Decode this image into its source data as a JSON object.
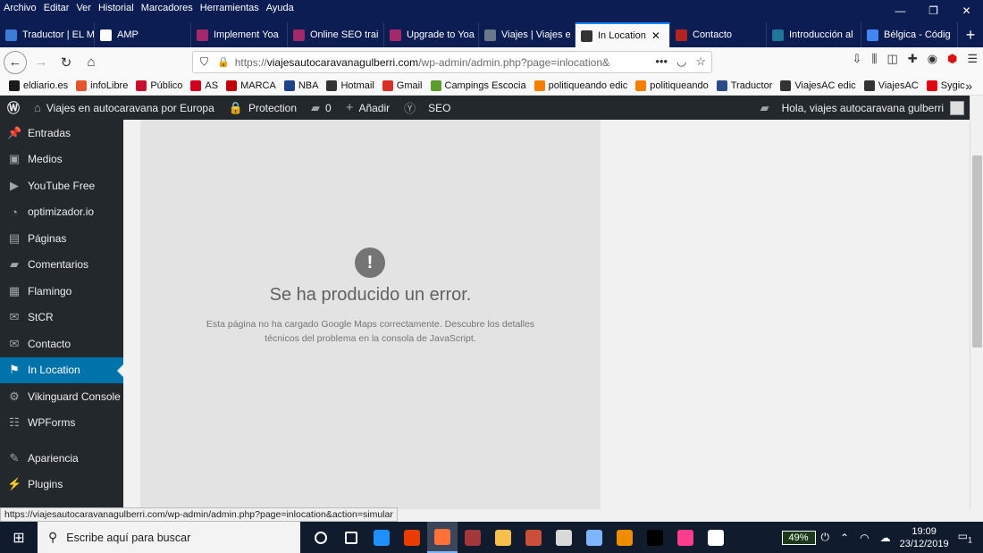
{
  "menubar": [
    "Archivo",
    "Editar",
    "Ver",
    "Historial",
    "Marcadores",
    "Herramientas",
    "Ayuda"
  ],
  "window_controls": [
    "—",
    "❐",
    "✕"
  ],
  "tabs": [
    {
      "label": "Traductor | EL M",
      "color": "#3c7bd6"
    },
    {
      "label": "AMP",
      "color": "#ffffff"
    },
    {
      "label": "Implement Yoa",
      "color": "#a4286a"
    },
    {
      "label": "Online SEO trai",
      "color": "#a4286a"
    },
    {
      "label": "Upgrade to Yoa",
      "color": "#a4286a"
    },
    {
      "label": "Viajes | Viajes e",
      "color": "#6b7a8a"
    },
    {
      "label": "In Location",
      "color": "#333333"
    },
    {
      "label": "Contacto",
      "color": "#b5241e"
    },
    {
      "label": "Introducción al",
      "color": "#21759b"
    },
    {
      "label": "Bélgica - Códig",
      "color": "#4285f4"
    }
  ],
  "url": {
    "prefix": "https://",
    "domain": "viajesautocaravanagulberri.com",
    "path": "/wp-admin/admin.php?page=inlocation&ac"
  },
  "bookmarks": [
    {
      "label": "eldiario.es",
      "color": "#1a1a1a"
    },
    {
      "label": "infoLibre",
      "color": "#e4572e"
    },
    {
      "label": "Público",
      "color": "#c8102e"
    },
    {
      "label": "AS",
      "color": "#d0021b"
    },
    {
      "label": "MARCA",
      "color": "#c20000"
    },
    {
      "label": "NBA",
      "color": "#1d428a"
    },
    {
      "label": "Hotmail",
      "color": "#333333"
    },
    {
      "label": "Gmail",
      "color": "#d93025"
    },
    {
      "label": "Campings Escocia",
      "color": "#5c9c2a"
    },
    {
      "label": "politiqueando edic",
      "color": "#f57d00"
    },
    {
      "label": "politiqueando",
      "color": "#f57d00"
    },
    {
      "label": "Traductor",
      "color": "#2b4c8c"
    },
    {
      "label": "ViajesAC edic",
      "color": "#333333"
    },
    {
      "label": "ViajesAC",
      "color": "#333333"
    },
    {
      "label": "Sygic",
      "color": "#e30613"
    }
  ],
  "adminbar": {
    "site": "Viajes en autocaravana por Europa",
    "protection": "Protection",
    "comments": "0",
    "add": "Añadir",
    "seo": "SEO",
    "greeting": "Hola, viajes autocaravana gulberri"
  },
  "sidebar": [
    {
      "label": "Entradas",
      "icon": "pin-icon",
      "glyph": "📌"
    },
    {
      "label": "Medios",
      "icon": "media-icon",
      "glyph": "▣"
    },
    {
      "label": "YouTube Free",
      "icon": "youtube-icon",
      "glyph": "▶"
    },
    {
      "label": "optimizador.io",
      "icon": "gauge-icon",
      "glyph": "◔"
    },
    {
      "label": "Páginas",
      "icon": "pages-icon",
      "glyph": "▤"
    },
    {
      "label": "Comentarios",
      "icon": "comment-icon",
      "glyph": "▰"
    },
    {
      "label": "Flamingo",
      "icon": "flamingo-icon",
      "glyph": "▦"
    },
    {
      "label": "StCR",
      "icon": "mail-icon",
      "glyph": "✉"
    },
    {
      "label": "Contacto",
      "icon": "mail-icon",
      "glyph": "✉"
    },
    {
      "label": "In Location",
      "icon": "map-icon",
      "glyph": "⚑"
    },
    {
      "label": "Vikinguard Console",
      "icon": "gear-icon",
      "glyph": "⚙"
    },
    {
      "label": "WPForms",
      "icon": "forms-icon",
      "glyph": "☷"
    },
    {
      "label": "Apariencia",
      "icon": "brush-icon",
      "glyph": "✎"
    },
    {
      "label": "Plugins",
      "icon": "plugin-icon",
      "glyph": "⚡"
    }
  ],
  "error": {
    "title": "Se ha producido un error.",
    "description": "Esta página no ha cargado Google Maps correctamente. Descubre los detalles técnicos del problema en la consola de JavaScript."
  },
  "status_url": "https://viajesautocaravanagulberri.com/wp-admin/admin.php?page=inlocation&action=simular",
  "taskbar": {
    "search_placeholder": "Escribe aquí para buscar",
    "battery": "49%",
    "time": "19:09",
    "date": "23/12/2019",
    "notifications": "1",
    "apps": [
      {
        "name": "cortana-icon",
        "color": "#ffffff"
      },
      {
        "name": "taskview-icon",
        "color": "#ffffff"
      },
      {
        "name": "edge-icon",
        "color": "#1e90ff"
      },
      {
        "name": "office-icon",
        "color": "#eb3c00"
      },
      {
        "name": "firefox-icon",
        "color": "#ff7139"
      },
      {
        "name": "access-icon",
        "color": "#a4373a"
      },
      {
        "name": "explorer-icon",
        "color": "#f8c04b"
      },
      {
        "name": "publisher-icon",
        "color": "#c94f3a"
      },
      {
        "name": "paint-icon",
        "color": "#d9d9d9"
      },
      {
        "name": "photos-icon",
        "color": "#7fb5ff"
      },
      {
        "name": "vlc-icon",
        "color": "#f08c00"
      },
      {
        "name": "tidal-icon",
        "color": "#000000"
      },
      {
        "name": "itunes-icon",
        "color": "#fc3c8d"
      },
      {
        "name": "mail-icon",
        "color": "#ffffff"
      }
    ]
  }
}
